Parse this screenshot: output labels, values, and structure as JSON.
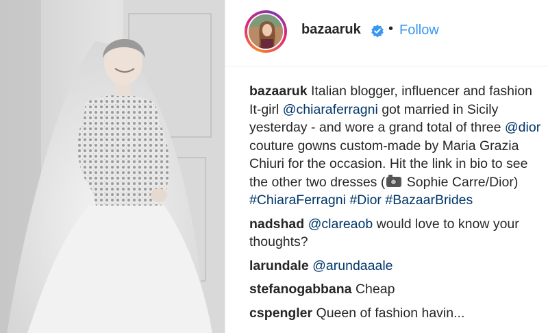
{
  "post": {
    "image_alt": "black and white photo of bride in lace wedding gown with veil",
    "author": "bazaaruk",
    "verified_icon": "verified-badge-icon",
    "separator": "•",
    "follow_label": "Follow"
  },
  "caption": {
    "user": "bazaaruk",
    "t1": " Italian blogger, influencer and fashion It-girl ",
    "m1": "@chiaraferragni",
    "t2": " got married in Sicily yesterday - and wore a grand total of three ",
    "m2": "@dior",
    "t3": " couture gowns custom-made by Maria Grazia Chiuri for the occasion. Hit the link in bio to see the other two dresses (",
    "camera_icon": "camera-emoji-icon",
    "t4": " Sophie Carre/Dior) ",
    "h1": "#ChiaraFerragni",
    "h2": "#Dior",
    "h3": "#BazaarBrides"
  },
  "comments": [
    {
      "user": "nadshad",
      "mention": "@clareaob",
      "text": " would love to know your thoughts?"
    },
    {
      "user": "larundale",
      "mention": "@arundaaale",
      "text": ""
    },
    {
      "user": "stefanogabbana",
      "mention": "",
      "text": "Cheap"
    },
    {
      "user": "cspengler",
      "mention": "",
      "text": "Queen of fashion havin..."
    }
  ],
  "colors": {
    "link": "#3897f0",
    "mention": "#003569",
    "text": "#262626"
  }
}
